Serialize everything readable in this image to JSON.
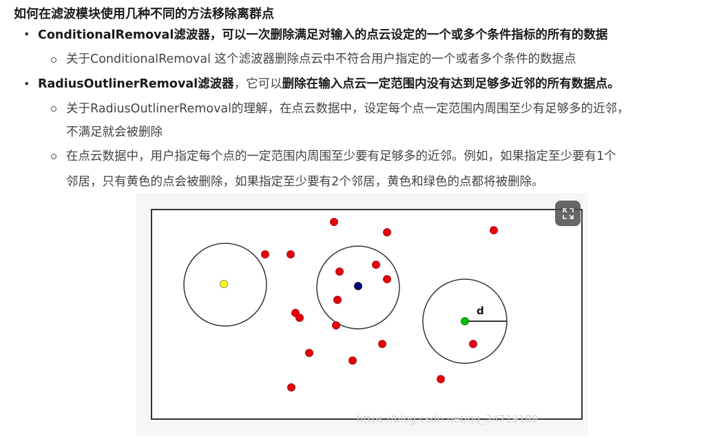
{
  "heading": "如何在滤波模块使用几种不同的方法移除离群点",
  "items": [
    {
      "bold": "ConditionalRemoval滤波器，可以一次删除满足对输入的点云设定的一个或多个条件指标的所有的数据",
      "subitems": [
        "关于ConditionalRemoval 这个滤波器删除点云中不符合用户指定的一个或者多个条件的数据点"
      ]
    },
    {
      "bold1": "RadiusOutlinerRemoval滤波器",
      "normal": "，它可以",
      "bold2": "删除在输入点云一定范围内没有达到足够多近邻的所有数据点。",
      "subitems": [
        {
          "line1": "关于RadiusOutlinerRemoval的理解，在点云数据中，设定每个点一定范围内周围至少有足够多的近邻，",
          "line2": "不满足就会被删除"
        },
        {
          "line1": "在点云数据中，用户指定每个点的一定范围内周围至少要有足够多的近邻。例如，如果指定至少要有1个",
          "line2": "邻居，只有黄色的点会被删除，如果指定至少要有2个邻居，黄色和绿色的点都将被删除。"
        }
      ]
    }
  ],
  "figure": {
    "radius_label": "d",
    "watermark": "https://blog.csdn.net/qq_34719188",
    "colors": {
      "outlier": "#e8000b",
      "yellow_point": "#ffff00",
      "blue_point": "#000080",
      "green_point": "#00c000"
    }
  },
  "expand_icon": "expand-icon"
}
